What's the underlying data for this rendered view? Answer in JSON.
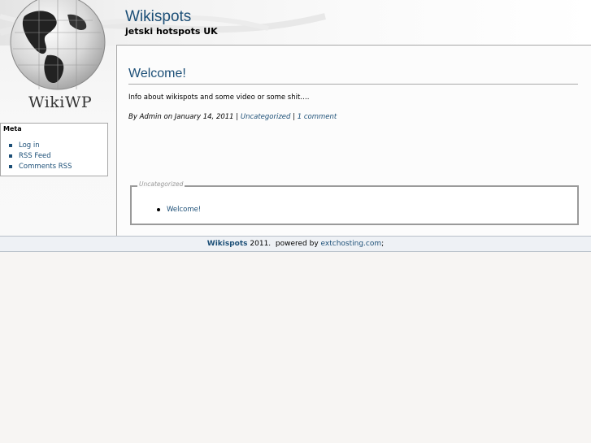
{
  "header": {
    "site_title": "Wikispots",
    "site_subtitle": "jetski hotspots UK",
    "logo_text": "WikiWP"
  },
  "sidebar": {
    "meta_title": "Meta",
    "links": [
      {
        "label": "Log in"
      },
      {
        "label": "RSS Feed"
      },
      {
        "label": "Comments RSS"
      }
    ]
  },
  "post": {
    "title": "Welcome!",
    "body": "Info about wikispots and some video or some shit….",
    "meta": {
      "prefix": "By Admin on January 14, 2011 | ",
      "category": "Uncategorized",
      "separator": " | ",
      "comments": "1 comment"
    }
  },
  "category_box": {
    "legend": "Uncategorized",
    "items": [
      {
        "label": "Welcome!"
      }
    ]
  },
  "footer": {
    "site_name": "Wikispots",
    "year_text": " 2011.  powered by ",
    "host_link": "extchosting.com",
    "suffix": ";"
  },
  "colors": {
    "link": "#1c4f77",
    "background": "#f7f5f3"
  }
}
